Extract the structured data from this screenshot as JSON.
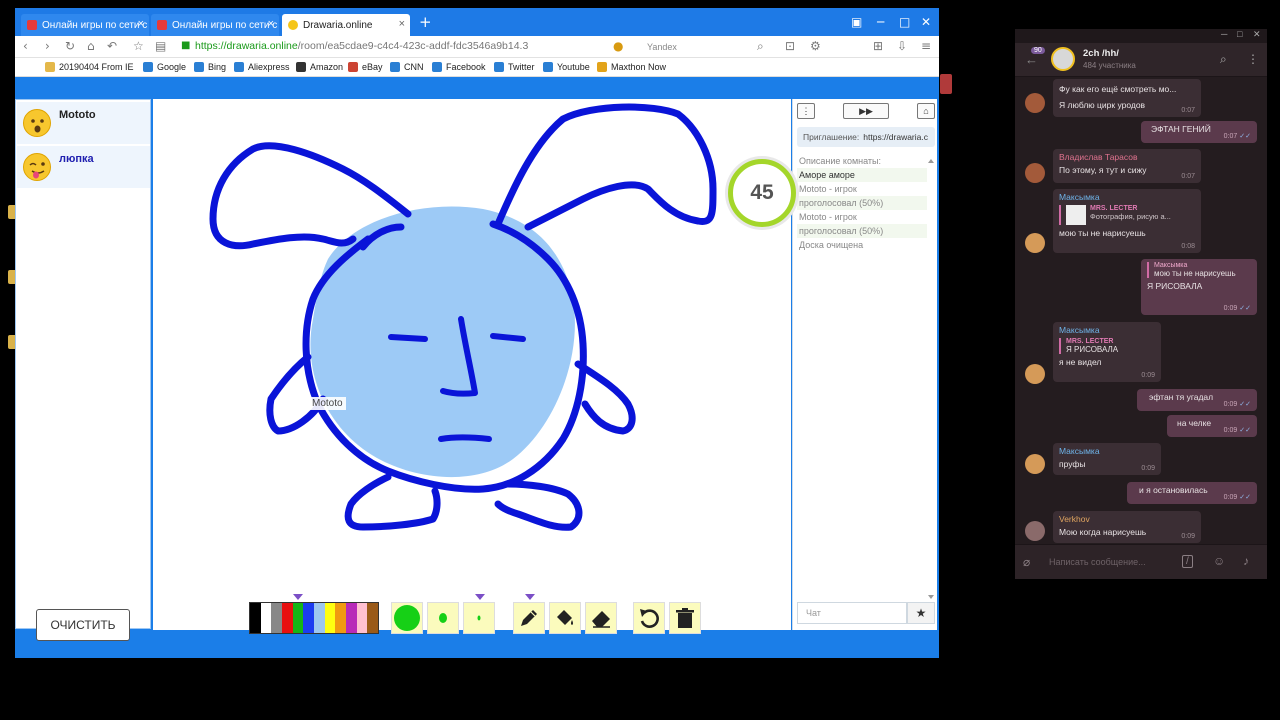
{
  "browser": {
    "tabs": [
      {
        "label": "Онлайн игры по сети с"
      },
      {
        "label": "Онлайн игры по сети с"
      },
      {
        "label": "Drawaria.online"
      }
    ],
    "new_tab_symbol": "+",
    "url_proto": "https://",
    "url_domain": "drawaria.online",
    "url_path": "/room/ea5cdae9-c4c4-423c-addf-fdc3546a9b14.3",
    "search_placeholder": "Yandex",
    "bookmarks": [
      "20190404 From IE",
      "Google",
      "Bing",
      "Aliexpress",
      "Amazon",
      "eBay",
      "CNN",
      "Facebook",
      "Twitter",
      "Youtube",
      "Maxthon Now"
    ]
  },
  "game": {
    "players": [
      {
        "name": "Mototo",
        "color": "#222222",
        "icon": "surprised-face-icon"
      },
      {
        "name": "люпка",
        "color": "#2020b0",
        "icon": "tongue-face-icon"
      }
    ],
    "clear_label": "ОЧИСТИТЬ",
    "timer": "45",
    "cursor_label": "Mototo",
    "invite_label": "Приглашение:",
    "invite_link": "https://drawaria.c",
    "log": [
      {
        "text": "Описание комнаты:"
      },
      {
        "text": "Аморе аморе"
      },
      {
        "text": "Mototo - игрок"
      },
      {
        "text": "проголосовал (50%)"
      },
      {
        "text": "Mototo - игрок"
      },
      {
        "text": "проголосовал (50%)"
      },
      {
        "text": "Доска очищена"
      }
    ],
    "chat_placeholder": "Чат",
    "palette": [
      "#000000",
      "#ffffff",
      "#888888",
      "#e81010",
      "#16b516",
      "#1c3cf0",
      "#9dc7ef",
      "#ffff10",
      "#f09a10",
      "#b82ab8",
      "#ffc0d0",
      "#9a5a18"
    ],
    "brush_color": "#16d016",
    "stroke_color": "#0a14d8",
    "fill_color": "#9dcaf6"
  },
  "telegram": {
    "back_badge": "90",
    "chat_name": "2ch /hh/",
    "members": "484 участника",
    "messages": [
      {
        "dir": "in",
        "text": "Фу как его ещё смотреть мо...",
        "text2": "Я люблю цирк уродов",
        "time": "0:07"
      },
      {
        "dir": "out",
        "text": "ЭФТАН ГЕНИЙ",
        "time": "0:07"
      },
      {
        "dir": "in",
        "sender": "Владислав Тарасов",
        "sender_color": "#e0738f",
        "text": "По этому, я тут и сижу",
        "time": "0:07"
      },
      {
        "dir": "in",
        "sender": "Максымка",
        "sender_color": "#6eb3e8",
        "quote_name": "MRS. LECTER",
        "quote_text": "Фотография, рисую а...",
        "text": "мою ты не нарисуешь",
        "time": "0:08"
      },
      {
        "dir": "out",
        "quote_name": "Максымка",
        "quote_text": "мою ты не нарисуешь",
        "text": "Я РИСОВАЛА",
        "time": "0:09"
      },
      {
        "dir": "in",
        "sender": "Максымка",
        "sender_color": "#6eb3e8",
        "quote_name": "MRS. LECTER",
        "quote_text": "Я РИСОВАЛА",
        "text": "я не видел",
        "time": "0:09"
      },
      {
        "dir": "out",
        "text": "эфтан тя угадал",
        "time": "0:09"
      },
      {
        "dir": "out",
        "text": "на челке",
        "time": "0:09"
      },
      {
        "dir": "in",
        "sender": "Максымка",
        "sender_color": "#6eb3e8",
        "text": "пруфы",
        "time": "0:09"
      },
      {
        "dir": "out",
        "text": "и я остановилась",
        "time": "0:09"
      },
      {
        "dir": "in",
        "sender": "Verkhov",
        "sender_color": "#e0a560",
        "text": "Мою когда нарисуешь",
        "time": "0:09"
      }
    ],
    "input_placeholder": "Написать сообщение..."
  }
}
